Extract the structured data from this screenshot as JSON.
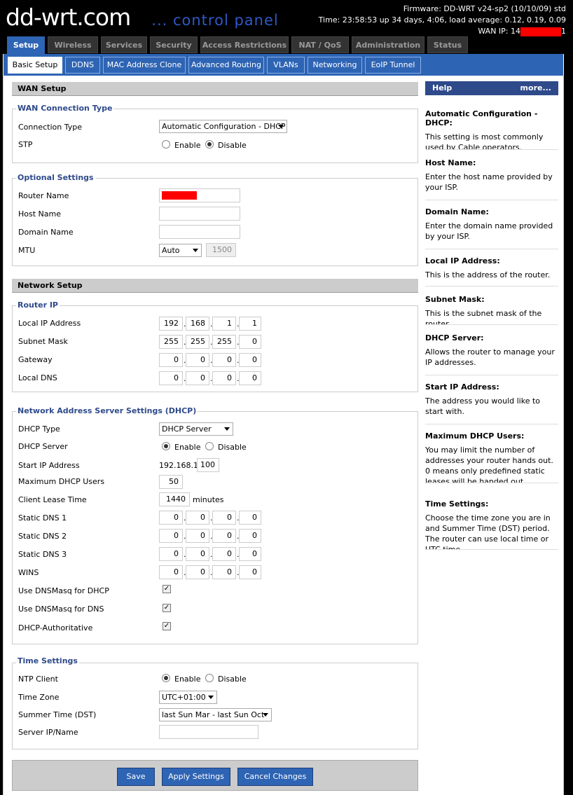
{
  "header": {
    "logo": "dd-wrt.com",
    "tagline": "... control panel",
    "firmware": "Firmware: DD-WRT v24-sp2 (10/10/09) std",
    "time": "Time: 23:58:53 up 34 days, 4:06, load average: 0.12, 0.19, 0.09",
    "wan_ip_prefix": "WAN IP: 14",
    "wan_ip_suffix": "1"
  },
  "main_tabs": [
    "Setup",
    "Wireless",
    "Services",
    "Security",
    "Access Restrictions",
    "NAT / QoS",
    "Administration",
    "Status"
  ],
  "sub_tabs": [
    "Basic Setup",
    "DDNS",
    "MAC Address Clone",
    "Advanced Routing",
    "VLANs",
    "Networking",
    "EoIP Tunnel"
  ],
  "wan": {
    "title": "WAN Setup",
    "conn_legend": "WAN Connection Type",
    "conn_label": "Connection Type",
    "conn_value": "Automatic Configuration - DHCP",
    "stp_label": "STP",
    "enable": "Enable",
    "disable": "Disable",
    "opt_legend": "Optional Settings",
    "router_name": "Router Name",
    "host_name": "Host Name",
    "domain_name": "Domain Name",
    "mtu": "MTU",
    "mtu_mode": "Auto",
    "mtu_value": "1500"
  },
  "network": {
    "title": "Network Setup",
    "router_ip_legend": "Router IP",
    "local_ip": "Local IP Address",
    "local_ip_val": [
      "192",
      "168",
      "1",
      "1"
    ],
    "subnet": "Subnet Mask",
    "subnet_val": [
      "255",
      "255",
      "255",
      "0"
    ],
    "gateway": "Gateway",
    "gateway_val": [
      "0",
      "0",
      "0",
      "0"
    ],
    "local_dns": "Local DNS",
    "local_dns_val": [
      "0",
      "0",
      "0",
      "0"
    ]
  },
  "dhcp": {
    "legend": "Network Address Server Settings (DHCP)",
    "type_label": "DHCP Type",
    "type_value": "DHCP Server",
    "server_label": "DHCP Server",
    "enable": "Enable",
    "disable": "Disable",
    "start_label": "Start IP Address",
    "start_prefix": "192.168.1.",
    "start_value": "100",
    "max_label": "Maximum DHCP Users",
    "max_value": "50",
    "lease_label": "Client Lease Time",
    "lease_value": "1440",
    "lease_unit": "minutes",
    "dns1": "Static DNS 1",
    "dns2": "Static DNS 2",
    "dns3": "Static DNS 3",
    "wins": "WINS",
    "zero": "0",
    "dnsmasq_dhcp": "Use DNSMasq for DHCP",
    "dnsmasq_dns": "Use DNSMasq for DNS",
    "authoritative": "DHCP-Authoritative"
  },
  "time": {
    "legend": "Time Settings",
    "ntp_label": "NTP Client",
    "enable": "Enable",
    "disable": "Disable",
    "tz_label": "Time Zone",
    "tz_value": "UTC+01:00",
    "dst_label": "Summer Time (DST)",
    "dst_value": "last Sun Mar - last Sun Oct",
    "server_label": "Server IP/Name"
  },
  "buttons": {
    "save": "Save",
    "apply": "Apply Settings",
    "cancel": "Cancel Changes"
  },
  "help": {
    "title": "Help",
    "more": "more...",
    "items": [
      {
        "title": "Automatic Configuration - DHCP:",
        "text": "This setting is most commonly used by Cable operators."
      },
      {
        "title": "Host Name:",
        "text": "Enter the host name provided by your ISP."
      },
      {
        "title": "Domain Name:",
        "text": "Enter the domain name provided by your ISP."
      },
      {
        "title": "Local IP Address:",
        "text": "This is the address of the router."
      },
      {
        "title": "Subnet Mask:",
        "text": "This is the subnet mask of the router."
      },
      {
        "title": "DHCP Server:",
        "text": "Allows the router to manage your IP addresses."
      },
      {
        "title": "Start IP Address:",
        "text": "The address you would like to start with."
      },
      {
        "title": "Maximum DHCP Users:",
        "text": "You may limit the number of addresses your router hands out. 0 means only predefined static leases will be handed out."
      },
      {
        "title": "Time Settings:",
        "text": "Choose the time zone you are in and Summer Time (DST) period. The router can use local time or UTC time."
      }
    ]
  },
  "colors": {
    "accent": "#2e64b4",
    "header_bg": "#000000",
    "legend": "#2e4a8a",
    "redaction": "#ff0000"
  }
}
